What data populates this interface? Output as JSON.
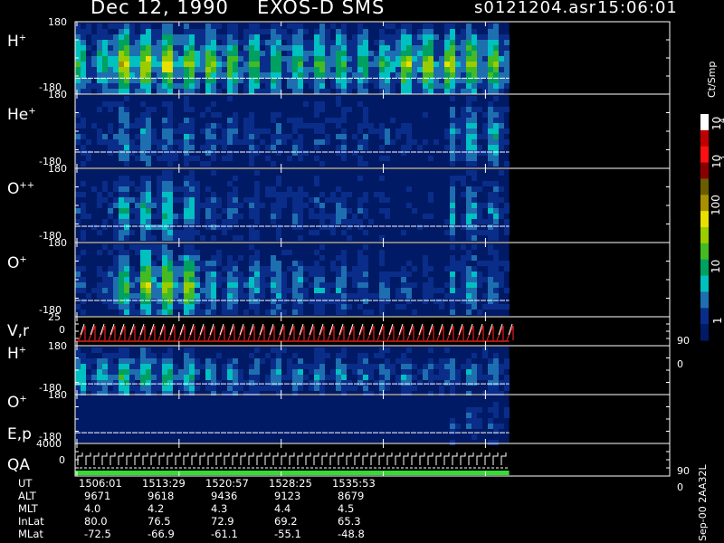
{
  "header": {
    "date": "Dec 12, 1990",
    "mission": "EXOS-D SMS",
    "file": "s0121204.asr",
    "time": "15:06:01"
  },
  "colorbar": {
    "unit_label": "Ct/Smp",
    "tick_labels": [
      "10",
      "4",
      "10",
      "3",
      "100",
      "10",
      "1"
    ],
    "colors": [
      "#ffffff",
      "#c00000",
      "#ff1010",
      "#8a0000",
      "#6b5c00",
      "#a89000",
      "#e8e000",
      "#9acc00",
      "#44bb22",
      "#00a060",
      "#00c0c0",
      "#1e6fb0",
      "#0a2d8a",
      "#001a66"
    ]
  },
  "side_note": "Sep-00 2AA32L",
  "panels": [
    {
      "id": "h-plus-1",
      "label": "H",
      "sup": "+",
      "ymax": "180",
      "ymin": "-180"
    },
    {
      "id": "he-plus",
      "label": "He",
      "sup": "+",
      "ymax": "180",
      "ymin": "-180"
    },
    {
      "id": "o-plus-plus",
      "label": "O",
      "sup": "++",
      "ymax": "180",
      "ymin": "-180"
    },
    {
      "id": "o-plus-1",
      "label": "O",
      "sup": "+",
      "ymax": "180",
      "ymin": "-180"
    },
    {
      "id": "v-r",
      "label": "V,r",
      "ymax": "25",
      "ymin": "0",
      "right_top": "90",
      "right_bottom": "0"
    },
    {
      "id": "h-plus-2",
      "label": "H",
      "sup": "+",
      "ymax": "180",
      "ymin": "-180"
    },
    {
      "id": "o-plus-2",
      "label": "O",
      "sup": "+",
      "ymax": "180",
      "ymin": "-180"
    },
    {
      "id": "e-p-qa",
      "label": "E,p",
      "label2": "QA",
      "ymax": "4000",
      "ymin": "0",
      "right_top": "90",
      "right_bottom": "0"
    }
  ],
  "orbit_table": {
    "row_labels": [
      "UT",
      "ALT",
      "MLT",
      "InLat",
      "MLat"
    ],
    "columns": [
      {
        "UT": "1506:01",
        "ALT": "9671",
        "MLT": "4.0",
        "InLat": "80.0",
        "MLat": "-72.5"
      },
      {
        "UT": "1513:29",
        "ALT": "9618",
        "MLT": "4.2",
        "InLat": "76.5",
        "MLat": "-66.9"
      },
      {
        "UT": "1520:57",
        "ALT": "9436",
        "MLT": "4.3",
        "InLat": "72.9",
        "MLat": "-61.1"
      },
      {
        "UT": "1528:25",
        "ALT": "9123",
        "MLT": "4.4",
        "InLat": "69.2",
        "MLat": "-55.1"
      },
      {
        "UT": "1535:53",
        "ALT": "8679",
        "MLT": "4.5",
        "InLat": "65.3",
        "MLat": "-48.8"
      }
    ]
  },
  "chart_data": {
    "type": "heatmap",
    "title": "Dec 12, 1990   EXOS-D SMS",
    "x_tick_labels": [
      "1506:01",
      "1513:29",
      "1520:57",
      "1528:25",
      "1535:53"
    ],
    "data_fraction_of_axis": 0.73,
    "colorbar_scale": "log",
    "colorbar_range": [
      1,
      10000
    ],
    "series": [
      {
        "name": "H+",
        "intensity_profile": [
          0.5,
          0.85,
          0.8,
          0.7,
          0.65,
          0.6,
          0.58,
          0.55,
          0.55,
          0.5,
          0.75,
          0.75,
          0.7,
          0.65
        ]
      },
      {
        "name": "He+",
        "intensity_profile": [
          0.15,
          0.35,
          0.3,
          0.25,
          0.25,
          0.2,
          0.2,
          0.2,
          0.2,
          0.2,
          0.15,
          0.1,
          0.4,
          0.4
        ]
      },
      {
        "name": "O++",
        "intensity_profile": [
          0.15,
          0.4,
          0.45,
          0.35,
          0.2,
          0.2,
          0.2,
          0.2,
          0.2,
          0.15,
          0.1,
          0.1,
          0.35,
          0.3
        ]
      },
      {
        "name": "O+",
        "intensity_profile": [
          0.2,
          0.55,
          0.75,
          0.7,
          0.35,
          0.35,
          0.35,
          0.3,
          0.3,
          0.25,
          0.2,
          0.15,
          0.35,
          0.3
        ]
      },
      {
        "name": "H+ (lower)",
        "intensity_profile": [
          0.4,
          0.55,
          0.55,
          0.45,
          0.35,
          0.3,
          0.3,
          0.3,
          0.3,
          0.3,
          0.3,
          0.25,
          0.3,
          0.3
        ]
      },
      {
        "name": "O+ (lower)",
        "intensity_profile": [
          0.0,
          0.0,
          0.0,
          0.0,
          0.0,
          0.0,
          0.0,
          0.0,
          0.0,
          0.0,
          0.0,
          0.0,
          0.2,
          0.2
        ]
      }
    ]
  }
}
